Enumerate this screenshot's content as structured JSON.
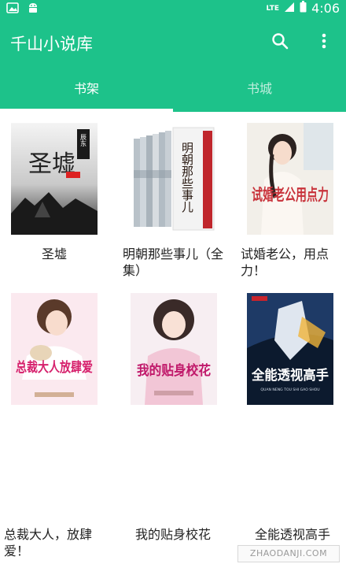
{
  "status_bar": {
    "network": "LTE",
    "time": "4:06"
  },
  "app": {
    "title": "千山小说库",
    "accent": "#1dc28a"
  },
  "toolbar": {
    "search_icon": "search-icon",
    "more_icon": "more-vert-icon"
  },
  "tabs": [
    {
      "label": "书架",
      "selected": true
    },
    {
      "label": "书城",
      "selected": false
    }
  ],
  "books": [
    {
      "title": "圣墟",
      "cover_text": "圣墟",
      "cover_sub": "辰东"
    },
    {
      "title": "明朝那些事儿（全集）",
      "cover_text": "明朝那些事儿"
    },
    {
      "title": "试婚老公，用点力！",
      "cover_text": "试婚老公用点力"
    },
    {
      "title": "总裁大人，放肆爱！",
      "cover_text": "总裁大人放肆爱"
    },
    {
      "title": "我的贴身校花",
      "cover_text": "我的贴身校花"
    },
    {
      "title": "全能透视高手",
      "cover_text": "全能透视高手",
      "cover_sub": "QUAN NENG TOU SHI GAO SHOU"
    }
  ],
  "watermark": "ZHAODANJI.COM"
}
